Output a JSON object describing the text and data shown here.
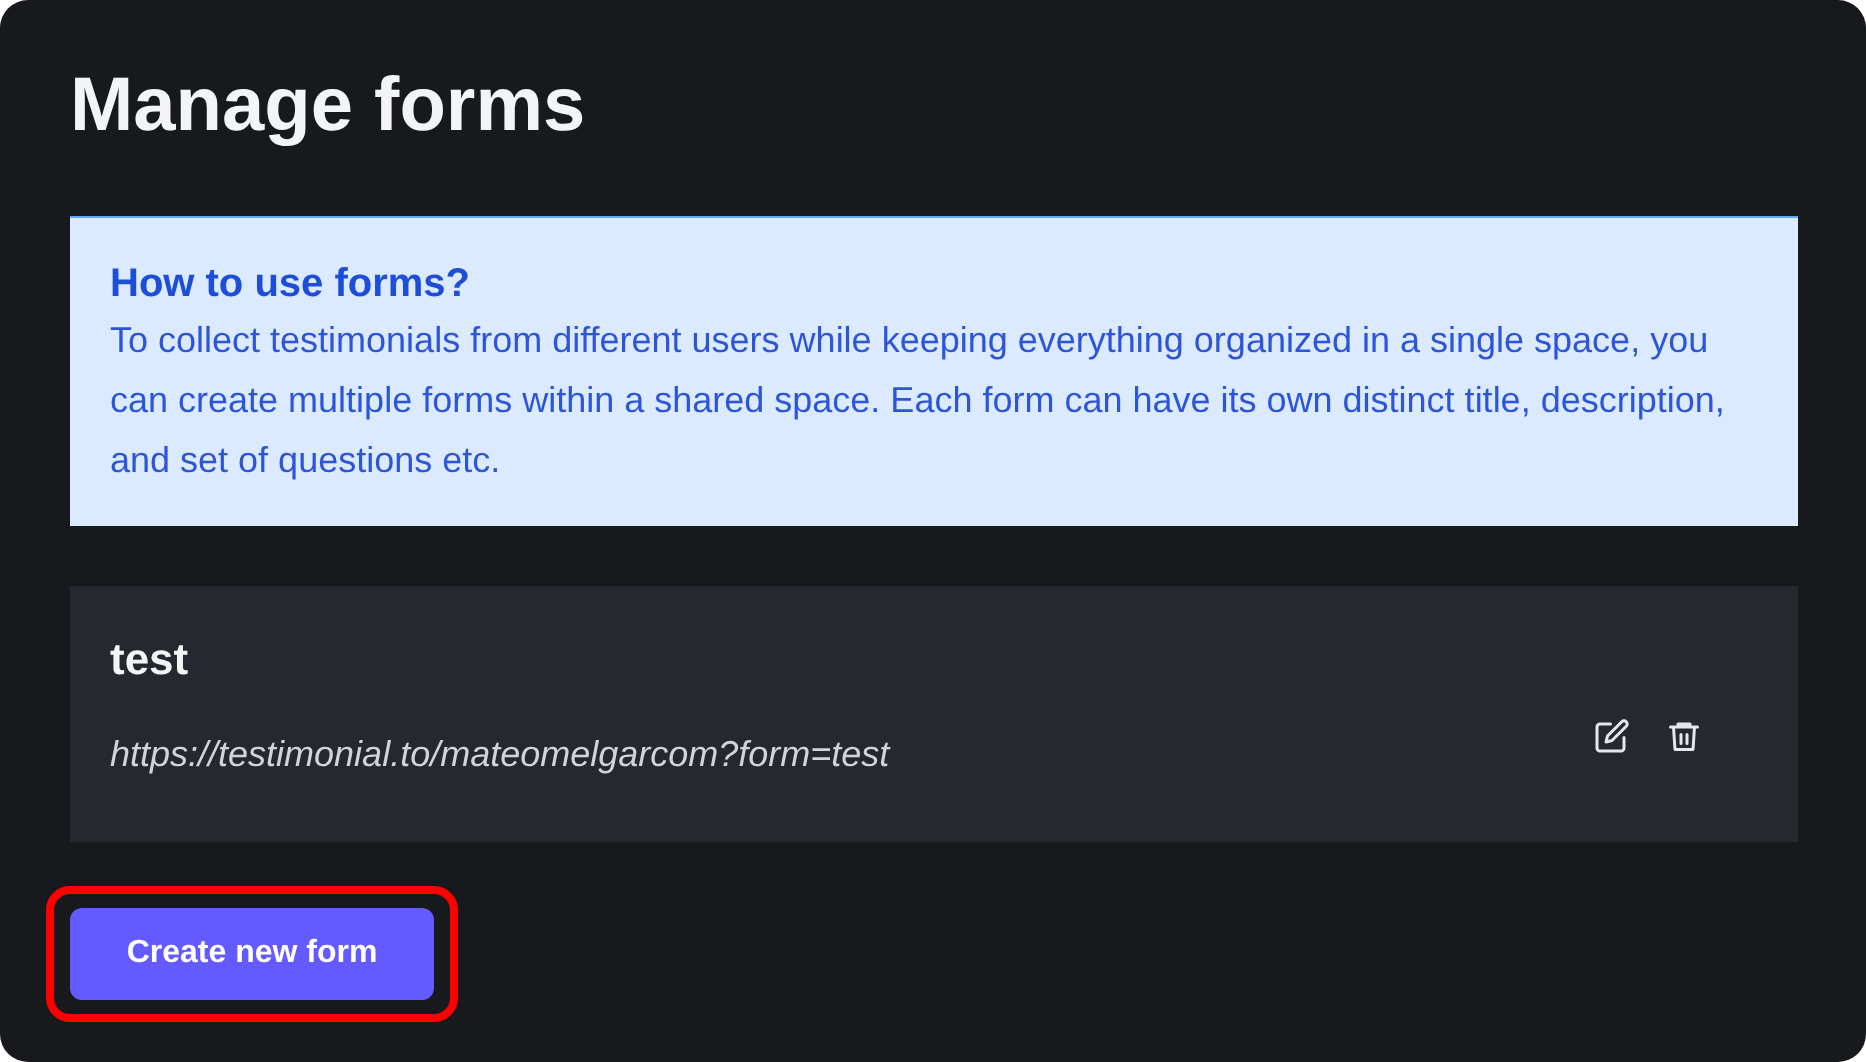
{
  "title": "Manage forms",
  "info": {
    "heading": "How to use forms?",
    "text": "To collect testimonials from different users while keeping everything organized in a single space, you can create multiple forms within a shared space. Each form can have its own distinct title, description, and set of questions etc."
  },
  "forms": [
    {
      "name": "test",
      "url": "https://testimonial.to/mateomelgarcom?form=test"
    }
  ],
  "create_button": {
    "label": "Create new form",
    "highlighted": true
  }
}
